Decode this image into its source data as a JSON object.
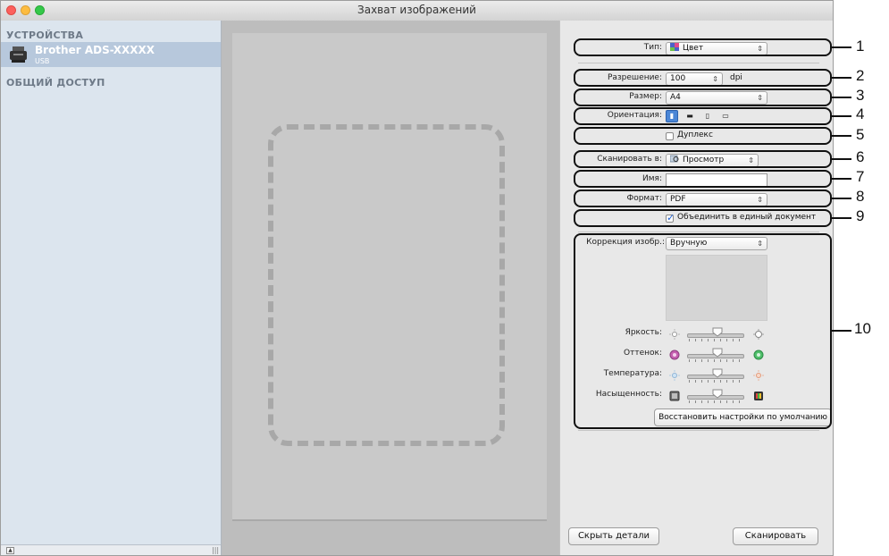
{
  "window": {
    "title": "Захват изображений"
  },
  "sidebar": {
    "devices_heading": "УСТРОЙСТВА",
    "device": {
      "name": "Brother ADS-XXXXX",
      "connection": "USB"
    },
    "shared_heading": "ОБЩИЙ ДОСТУП"
  },
  "settings": {
    "type": {
      "label": "Тип:",
      "value": "Цвет"
    },
    "resolution": {
      "label": "Разрешение:",
      "value": "100",
      "unit": "dpi"
    },
    "size": {
      "label": "Размер:",
      "value": "A4"
    },
    "orientation": {
      "label": "Ориентация:"
    },
    "duplex": {
      "label": "Дуплекс",
      "checked": false
    },
    "scan_to": {
      "label": "Сканировать в:",
      "value": "Просмотр"
    },
    "name": {
      "label": "Имя:",
      "value": ""
    },
    "format": {
      "label": "Формат:",
      "value": "PDF"
    },
    "combine": {
      "label": "Объединить в единый документ",
      "checked": true
    },
    "correction": {
      "label": "Коррекция изобр.:",
      "value": "Вручную"
    },
    "brightness": {
      "label": "Яркость:",
      "level": 0.55
    },
    "tint": {
      "label": "Оттенок:",
      "level": 0.55
    },
    "temperature": {
      "label": "Температура:",
      "level": 0.55
    },
    "saturation": {
      "label": "Насыщенность:",
      "level": 0.55
    },
    "restore_defaults": "Восстановить настройки по умолчанию"
  },
  "buttons": {
    "hide_details": "Скрыть детали",
    "scan": "Сканировать"
  },
  "callouts": [
    "1",
    "2",
    "3",
    "4",
    "5",
    "6",
    "7",
    "8",
    "9",
    "10"
  ]
}
